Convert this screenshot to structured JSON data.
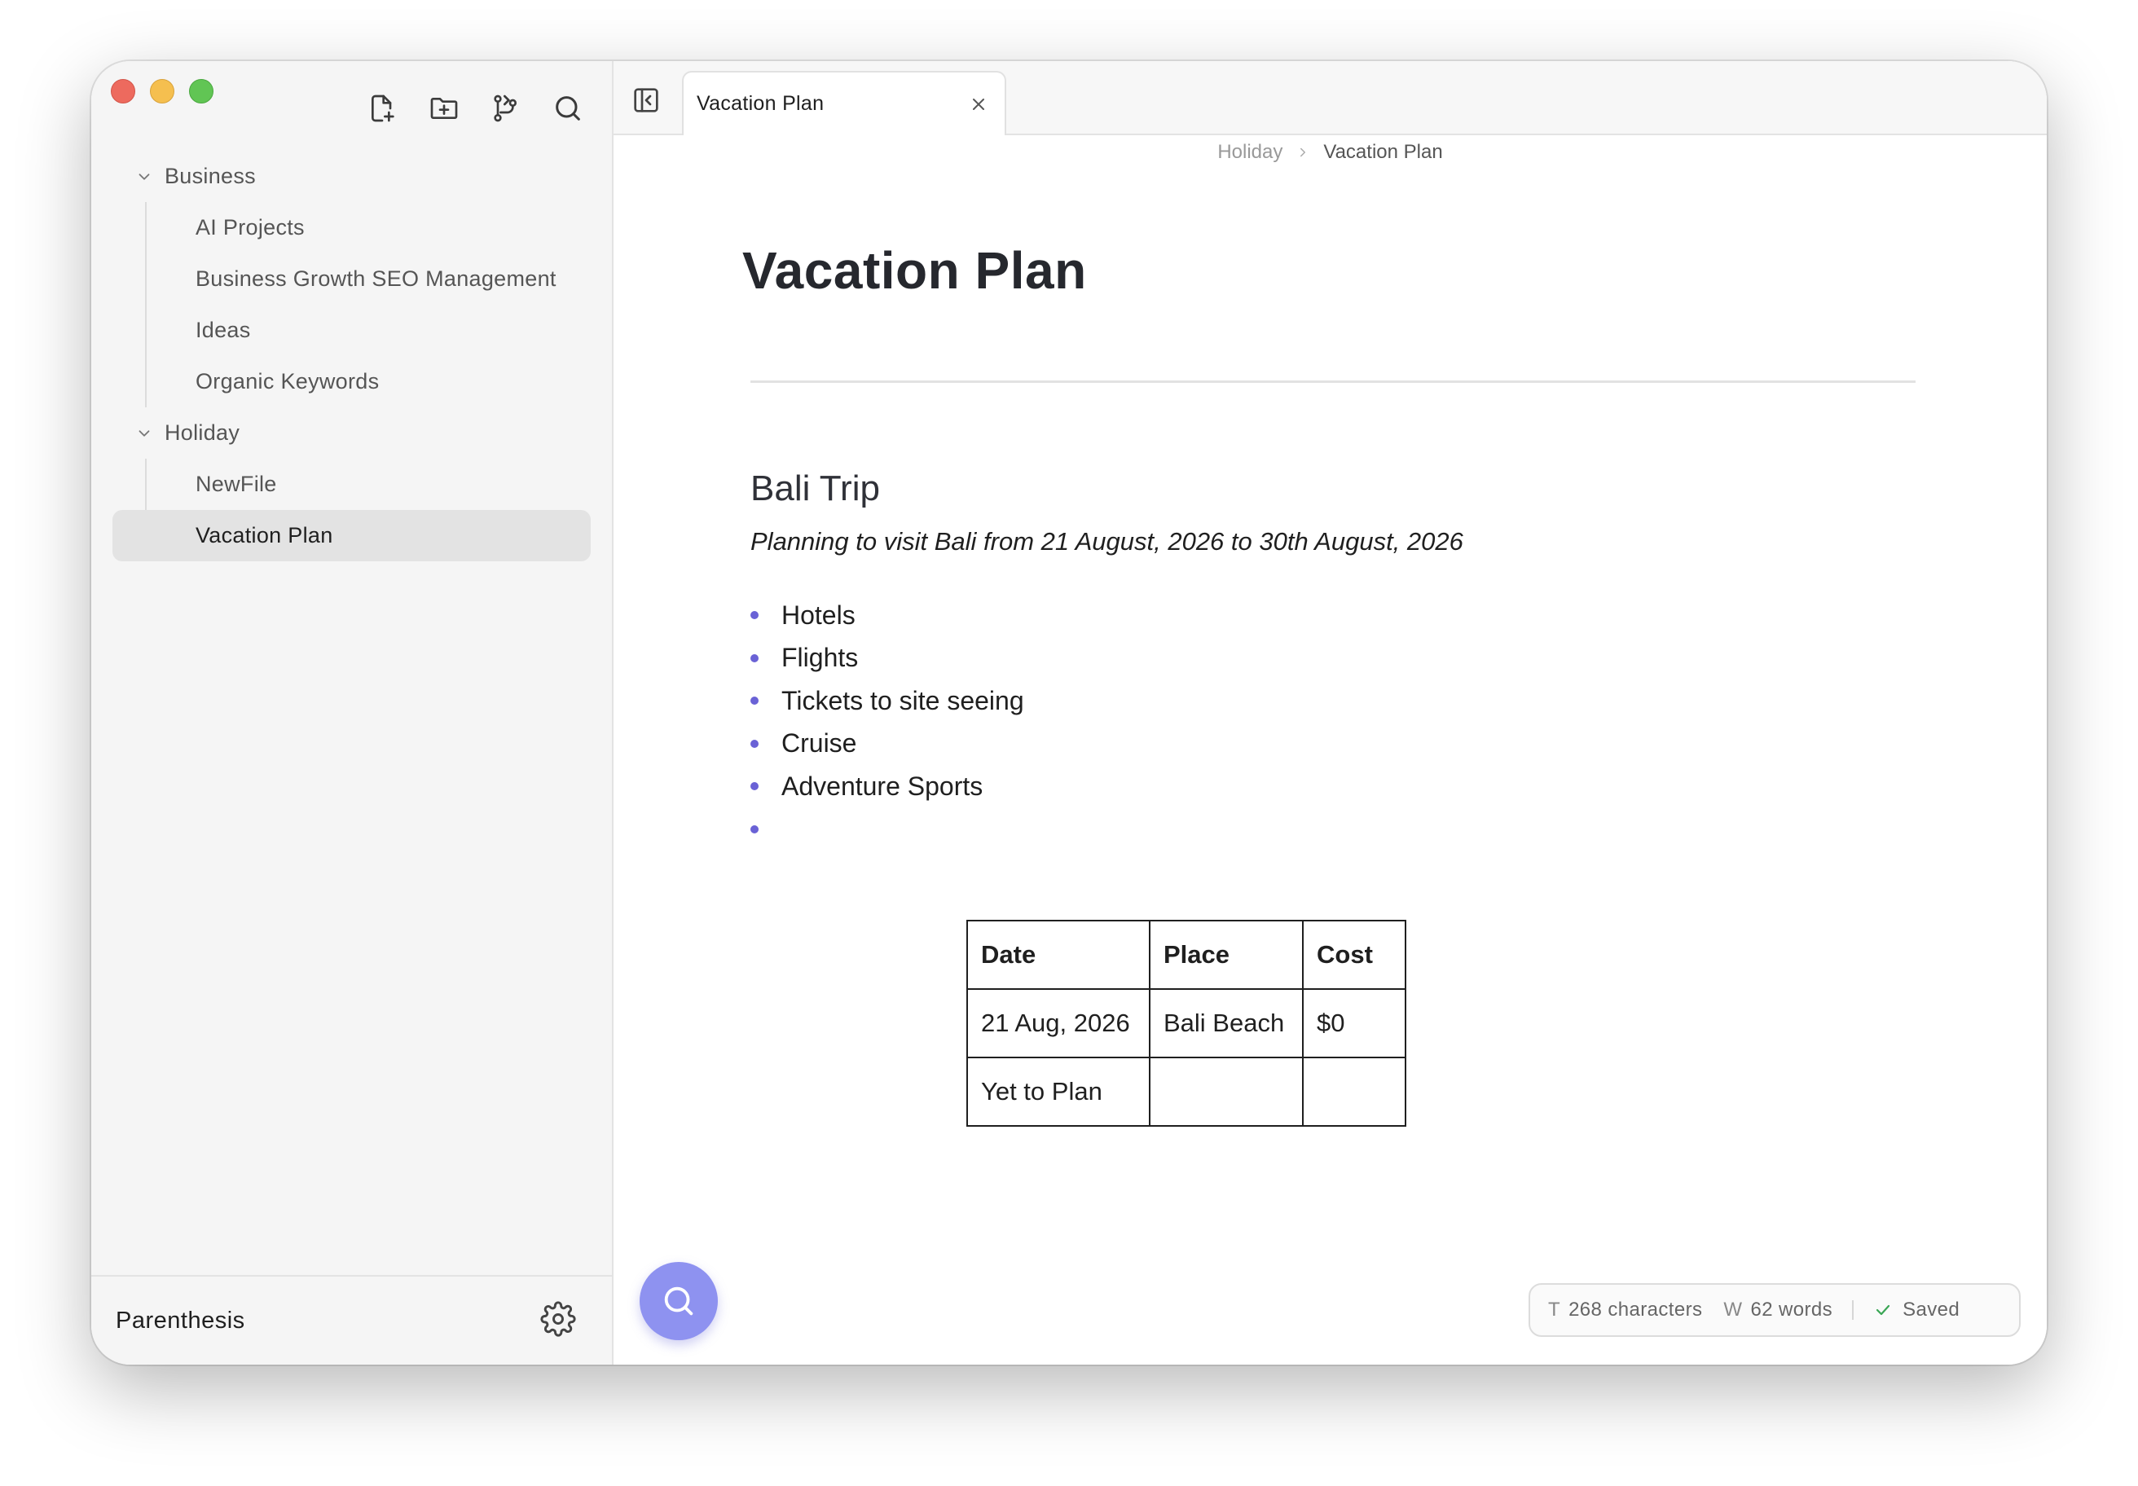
{
  "app_name": "Parenthesis",
  "sidebar": {
    "folders": [
      {
        "label": "Business",
        "files": [
          "AI Projects",
          "Business Growth SEO Management",
          "Ideas",
          "Organic Keywords"
        ]
      },
      {
        "label": "Holiday",
        "files": [
          "NewFile",
          "Vacation Plan"
        ]
      }
    ],
    "selected_file": "Vacation Plan"
  },
  "tab": {
    "title": "Vacation Plan"
  },
  "breadcrumb": {
    "parent": "Holiday",
    "current": "Vacation Plan"
  },
  "document": {
    "title": "Vacation Plan",
    "heading": "Bali Trip",
    "subtitle": "Planning to visit Bali from 21 August, 2026 to 30th August, 2026",
    "bullets": [
      "Hotels",
      "Flights",
      "Tickets to site seeing",
      "Cruise",
      "Adventure Sports",
      ""
    ],
    "table": {
      "headers": [
        "Date",
        "Place",
        "Cost"
      ],
      "rows": [
        [
          "21 Aug, 2026",
          "Bali Beach",
          "$0"
        ],
        [
          "Yet to Plan",
          "",
          ""
        ]
      ]
    }
  },
  "status": {
    "char_label": "T",
    "characters": "268 characters",
    "word_label": "W",
    "words": "62 words",
    "saved": "Saved"
  },
  "colors": {
    "accent": "#8e92f0",
    "bullet": "#6a62d6",
    "saved": "#3aa655"
  }
}
